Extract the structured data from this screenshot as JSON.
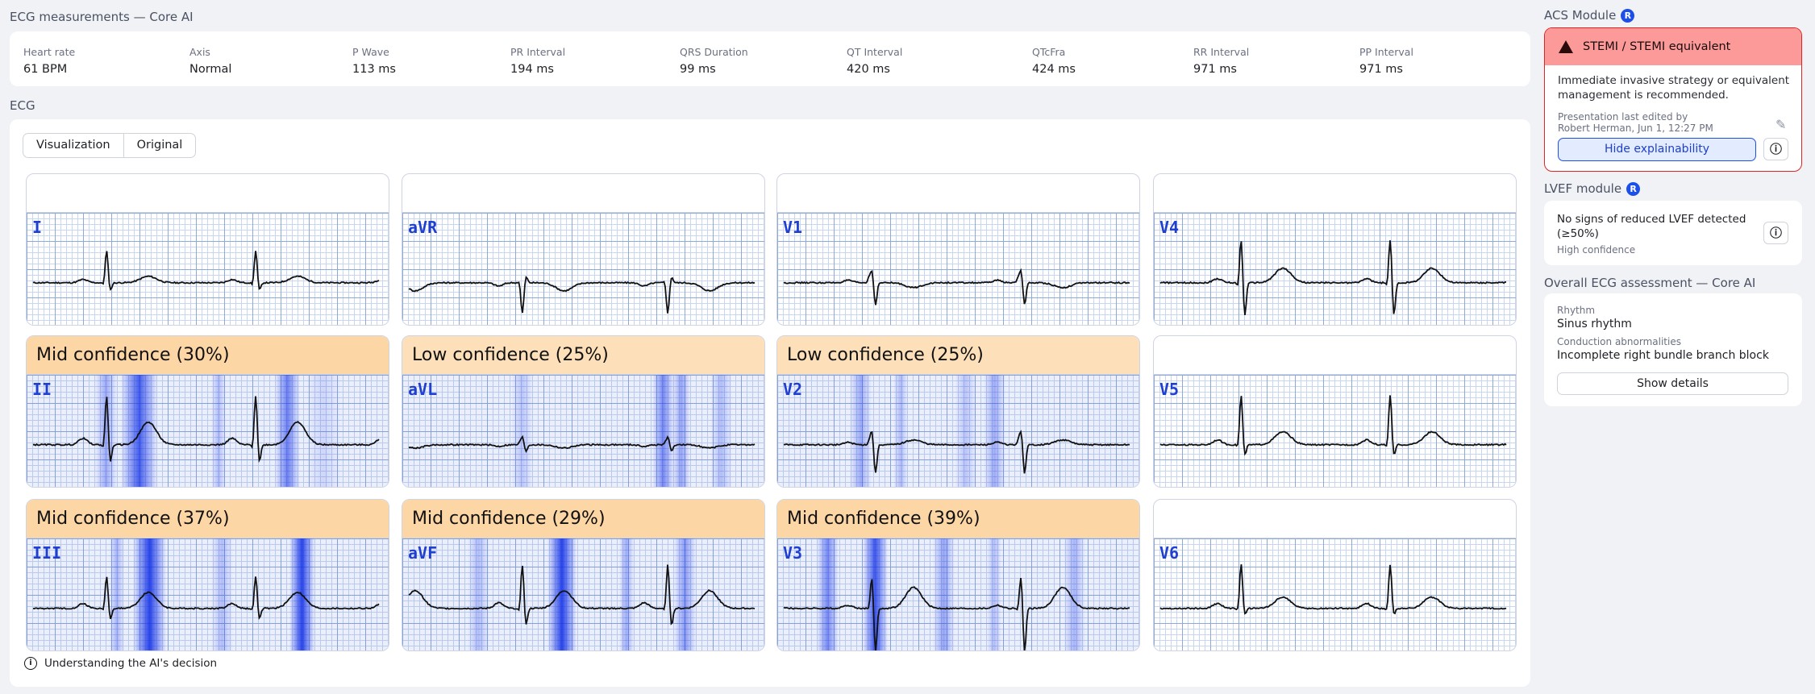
{
  "measurements": {
    "title": "ECG measurements — Core AI",
    "items": [
      {
        "label": "Heart rate",
        "value": "61 BPM"
      },
      {
        "label": "Axis",
        "value": "Normal"
      },
      {
        "label": "P Wave",
        "value": "113 ms"
      },
      {
        "label": "PR Interval",
        "value": "194 ms"
      },
      {
        "label": "QRS Duration",
        "value": "99 ms"
      },
      {
        "label": "QT Interval",
        "value": "420 ms"
      },
      {
        "label": "QTcFra",
        "value": "424 ms"
      },
      {
        "label": "RR Interval",
        "value": "971 ms"
      },
      {
        "label": "PP Interval",
        "value": "971 ms"
      }
    ]
  },
  "ecg": {
    "title": "ECG",
    "tabs": [
      "Visualization",
      "Original"
    ],
    "panels": [
      {
        "lead": "I",
        "confidence": ""
      },
      {
        "lead": "aVR",
        "confidence": ""
      },
      {
        "lead": "V1",
        "confidence": ""
      },
      {
        "lead": "V4",
        "confidence": ""
      },
      {
        "lead": "II",
        "confidence": "Mid confidence (30%)",
        "level": "mid"
      },
      {
        "lead": "aVL",
        "confidence": "Low confidence (25%)",
        "level": "low"
      },
      {
        "lead": "V2",
        "confidence": "Low confidence (25%)",
        "level": "low"
      },
      {
        "lead": "V5",
        "confidence": ""
      },
      {
        "lead": "III",
        "confidence": "Mid confidence (37%)",
        "level": "mid"
      },
      {
        "lead": "aVF",
        "confidence": "Mid confidence (29%)",
        "level": "mid"
      },
      {
        "lead": "V3",
        "confidence": "Mid confidence (39%)",
        "level": "mid"
      },
      {
        "lead": "V6",
        "confidence": ""
      }
    ],
    "footer": "Understanding the AI's decision"
  },
  "acs": {
    "title": "ACS Module",
    "badge": "R",
    "alert": "STEMI / STEMI equivalent",
    "message": "Immediate invasive strategy or equivalent management is recommended.",
    "edited_line1": "Presentation last edited by",
    "edited_line2": "Robert Herman, Jun 1, 12:27 PM",
    "button": "Hide explainability"
  },
  "lvef": {
    "title": "LVEF module",
    "badge": "R",
    "result": "No signs of reduced LVEF detected (≥50%)",
    "confidence": "High confidence"
  },
  "overall": {
    "title": "Overall ECG assessment — Core AI",
    "rhythm_label": "Rhythm",
    "rhythm": "Sinus rhythm",
    "conduction_label": "Conduction abnormalities",
    "conduction": "Incomplete right bundle branch block",
    "button": "Show details"
  },
  "colors": {
    "alert_bg": "#fc9a9a",
    "alert_border": "#e02424",
    "accent": "#1c4fe8",
    "mid": "#fdd6a6",
    "low": "#fde0ba"
  }
}
